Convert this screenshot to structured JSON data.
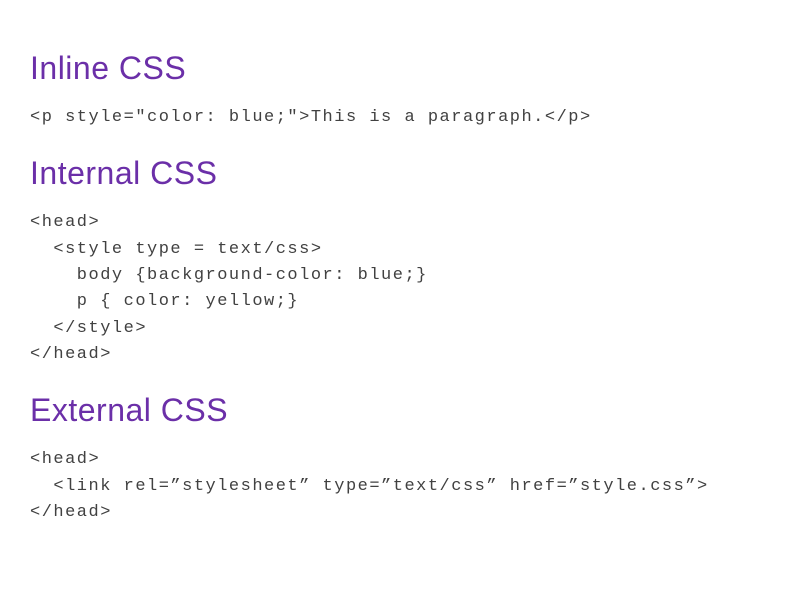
{
  "sections": {
    "inline": {
      "heading": "Inline CSS",
      "code": "<p style=\"color: blue;\">This is a paragraph.</p>"
    },
    "internal": {
      "heading": "Internal CSS",
      "code": "<head>\n  <style type = text/css>\n    body {background-color: blue;}\n    p { color: yellow;}\n  </style>\n</head>"
    },
    "external": {
      "heading": "External CSS",
      "code": "<head>\n  <link rel=”stylesheet” type=”text/css” href=”style.css”>\n</head>"
    }
  }
}
